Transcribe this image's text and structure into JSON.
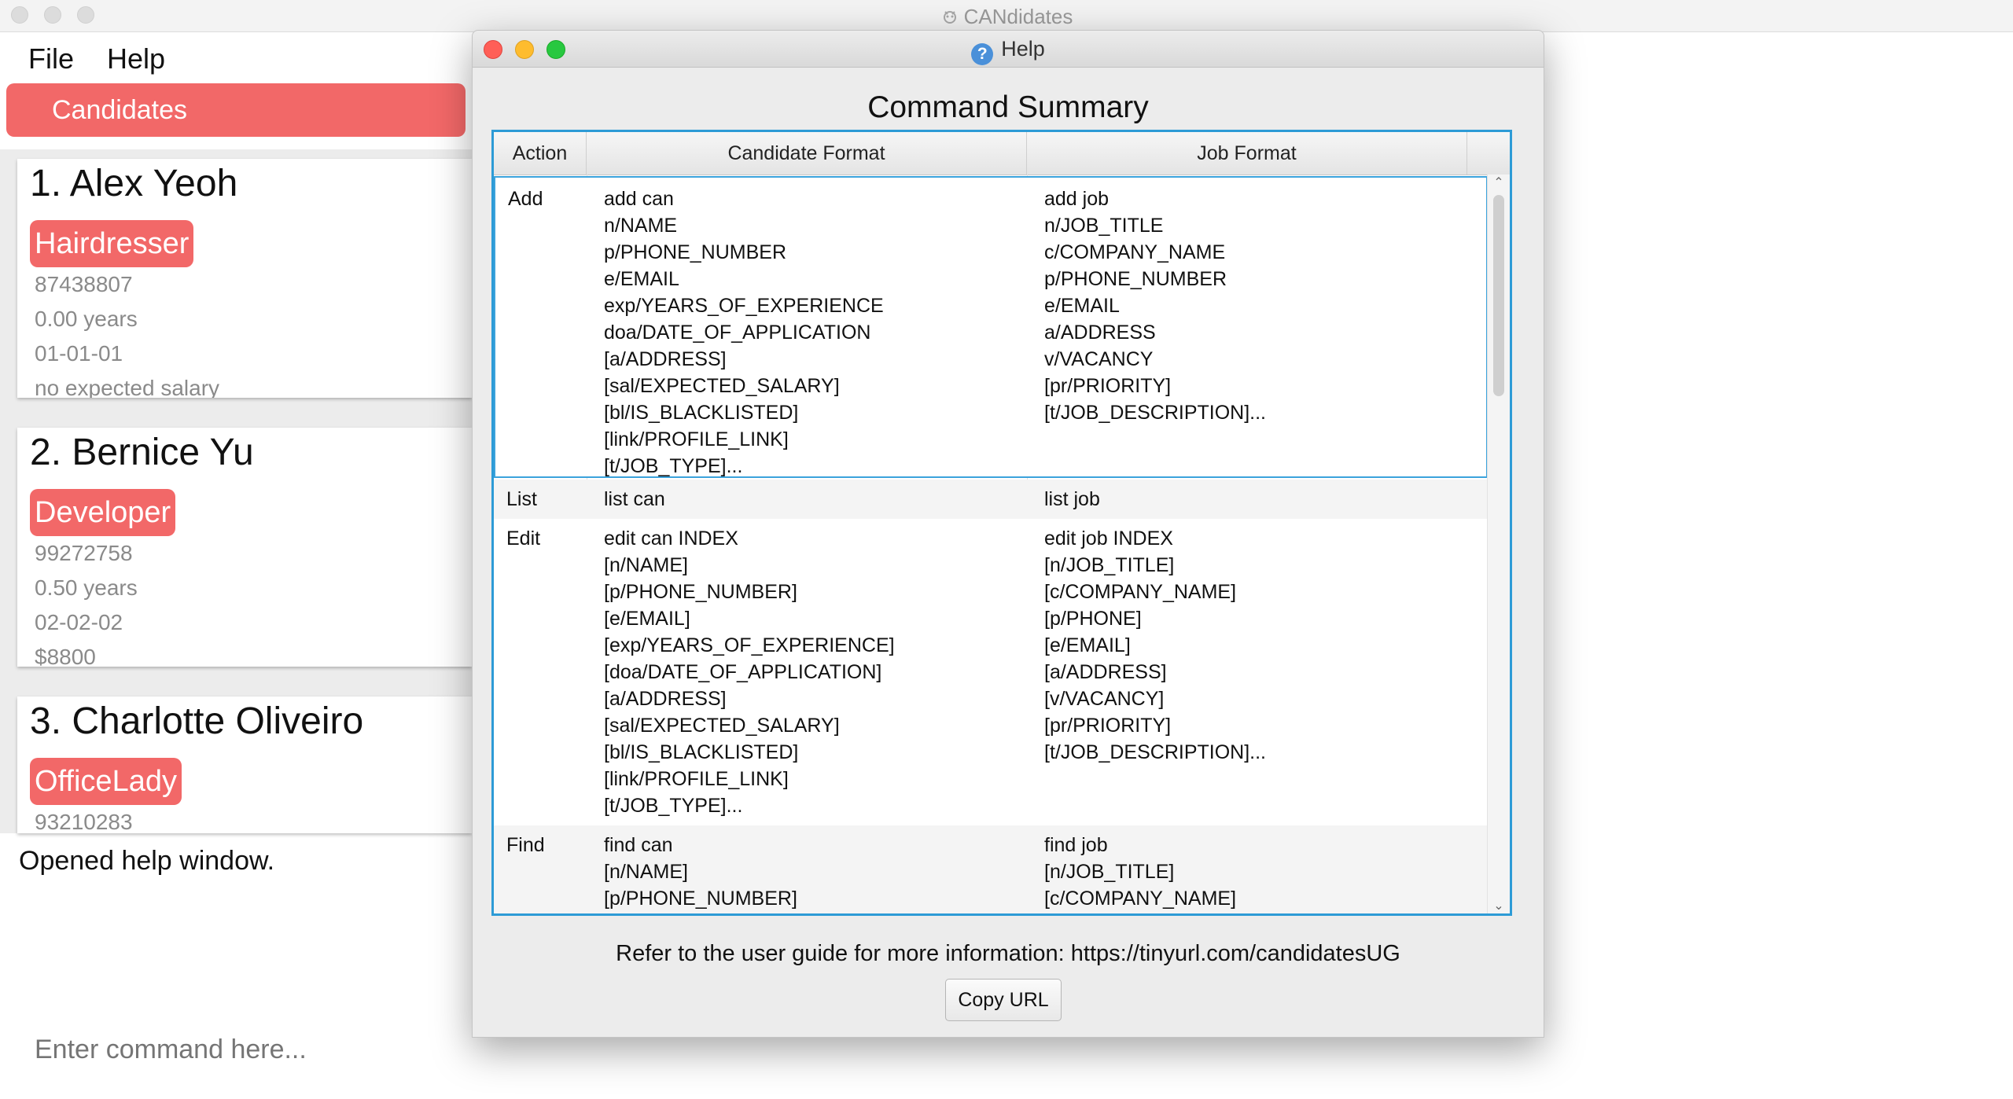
{
  "main_window": {
    "title": "CANdidates",
    "menu": [
      "File",
      "Help"
    ],
    "tab_label": "Candidates",
    "candidates": [
      {
        "title": "1.  Alex Yeoh",
        "tag": "Hairdresser",
        "lines": [
          "87438807",
          "0.00 years",
          "01-01-01",
          "no expected salary"
        ]
      },
      {
        "title": "2.  Bernice Yu",
        "tag": "Developer",
        "lines": [
          "99272758",
          "0.50 years",
          "02-02-02",
          "$8800"
        ]
      },
      {
        "title": "3.  Charlotte Oliveiro",
        "tag": "OfficeLady",
        "lines": [
          "93210283"
        ]
      }
    ],
    "result_text": "Opened help window.",
    "command_placeholder": "Enter command here..."
  },
  "help_window": {
    "title": "Help",
    "heading": "Command Summary",
    "columns": [
      "Action",
      "Candidate Format",
      "Job Format"
    ],
    "rows": [
      {
        "action": "Add",
        "candidate": [
          "add can",
          "n/NAME",
          "p/PHONE_NUMBER",
          "e/EMAIL",
          "exp/YEARS_OF_EXPERIENCE",
          "doa/DATE_OF_APPLICATION",
          "[a/ADDRESS]",
          "[sal/EXPECTED_SALARY]",
          "[bl/IS_BLACKLISTED]",
          "[link/PROFILE_LINK]",
          "[t/JOB_TYPE]..."
        ],
        "job": [
          "add job",
          "n/JOB_TITLE",
          "c/COMPANY_NAME",
          "p/PHONE_NUMBER",
          "e/EMAIL",
          "a/ADDRESS",
          "v/VACANCY",
          "[pr/PRIORITY]",
          "[t/JOB_DESCRIPTION]..."
        ]
      },
      {
        "action": "List",
        "candidate": [
          "list can"
        ],
        "job": [
          "list job"
        ]
      },
      {
        "action": "Edit",
        "candidate": [
          "edit can INDEX",
          "[n/NAME]",
          "[p/PHONE_NUMBER]",
          "[e/EMAIL]",
          "[exp/YEARS_OF_EXPERIENCE]",
          "[doa/DATE_OF_APPLICATION]",
          "[a/ADDRESS]",
          "[sal/EXPECTED_SALARY]",
          "[bl/IS_BLACKLISTED]",
          "[link/PROFILE_LINK]",
          "[t/JOB_TYPE]..."
        ],
        "job": [
          "edit job INDEX",
          "[n/JOB_TITLE]",
          "[c/COMPANY_NAME]",
          "[p/PHONE]",
          "[e/EMAIL]",
          "[a/ADDRESS]",
          "[v/VACANCY]",
          "[pr/PRIORITY]",
          "[t/JOB_DESCRIPTION]..."
        ]
      },
      {
        "action": "Find",
        "candidate": [
          "find can",
          "[n/NAME]",
          "[p/PHONE_NUMBER]"
        ],
        "job": [
          "find job",
          "[n/JOB_TITLE]",
          "[c/COMPANY_NAME]"
        ]
      }
    ],
    "refer_text": "Refer to the user guide for more information: https://tinyurl.com/candidatesUG",
    "copy_button": "Copy URL"
  },
  "colors": {
    "accent": "#f26868",
    "selection_border": "#2d9bd6",
    "close": "#ff5f57",
    "minimize": "#febc2e",
    "zoom": "#28c840"
  }
}
